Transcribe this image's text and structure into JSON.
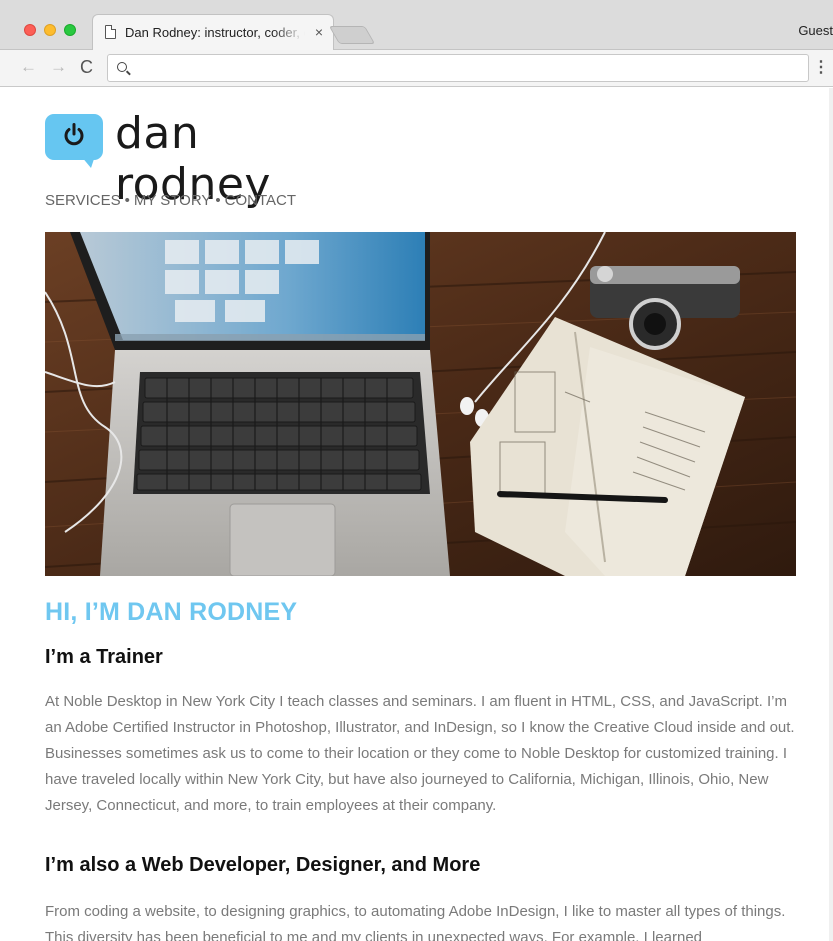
{
  "browser": {
    "tab_title": "Dan Rodney: instructor, coder, designer",
    "tab_close": "×",
    "profile_label": "Guest",
    "address_value": "",
    "nav_back": "←",
    "nav_forward": "→",
    "nav_reload": "C",
    "menu_glyph": "⋮"
  },
  "site": {
    "logo_text": "dan rodney",
    "nav": [
      {
        "label": "SERVICES"
      },
      {
        "label": "MY STORY"
      },
      {
        "label": "CONTACT"
      }
    ],
    "nav_separator": "•",
    "headline": "HI, I’M DAN RODNEY",
    "sections": [
      {
        "heading": "I’m a Trainer",
        "body": "At Noble Desktop in New York City I teach classes and seminars. I am fluent in HTML, CSS, and JavaScript. I’m an Adobe Certified Instructor in Photoshop, Illustrator, and InDesign, so I know the Creative Cloud inside and out. Businesses sometimes ask us to come to their location or they come to Noble Desktop for customized training. I have traveled locally within New York City, but have also journeyed to California, Michigan, Illinois, Ohio, New Jersey, Connecticut, and more, to train employees at their company."
      },
      {
        "heading": "I’m also a Web Developer, Designer, and More",
        "body": "From coding a website, to designing graphics, to automating Adobe InDesign, I like to master all types of things. This diversity has been beneficial to me and my clients in unexpected ways. For example, I learned"
      }
    ]
  },
  "colors": {
    "brand_blue": "#66c6f1",
    "heading_blue": "#6fc7f0",
    "body_text": "#7a7a7a",
    "nav_text": "#666666"
  }
}
